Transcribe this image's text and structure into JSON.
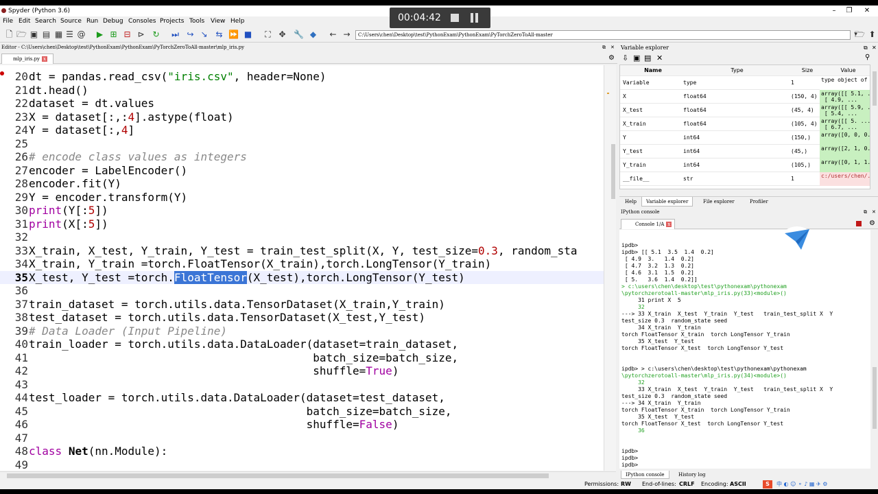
{
  "window": {
    "title": "Spyder (Python 3.6)"
  },
  "recorder": {
    "time": "00:04:42"
  },
  "menu": [
    "File",
    "Edit",
    "Search",
    "Source",
    "Run",
    "Debug",
    "Consoles",
    "Projects",
    "Tools",
    "View",
    "Help"
  ],
  "toolbar": {
    "path": "C:\\Users\\chen\\Desktop\\test\\PythonExam\\PythonExam\\PyTorchZeroToAll-master"
  },
  "editor": {
    "header": "Editor - C:\\Users\\chen\\Desktop\\test\\PythonExam\\PythonExam\\PyTorchZeroToAll-master\\mlp_iris.py",
    "tab": "mlp_iris.py",
    "lines": [
      {
        "n": "20",
        "parts": [
          [
            "",
            "dt = pandas.read_csv("
          ],
          [
            "str",
            "\"iris.csv\""
          ],
          [
            "",
            ", header=None)"
          ]
        ]
      },
      {
        "n": "21",
        "parts": [
          [
            "",
            "dt.head()"
          ]
        ]
      },
      {
        "n": "22",
        "parts": [
          [
            "",
            "dataset = dt.values"
          ]
        ]
      },
      {
        "n": "23",
        "parts": [
          [
            "",
            "X = dataset[:,:"
          ],
          [
            "num",
            "4"
          ],
          [
            "",
            "].astype(float)"
          ]
        ]
      },
      {
        "n": "24",
        "parts": [
          [
            "",
            "Y = dataset[:,"
          ],
          [
            "num",
            "4"
          ],
          [
            "",
            "]"
          ]
        ]
      },
      {
        "n": "25",
        "parts": []
      },
      {
        "n": "26",
        "parts": [
          [
            "cm",
            "# encode class values as integers"
          ]
        ]
      },
      {
        "n": "27",
        "parts": [
          [
            "",
            "encoder = LabelEncoder()"
          ]
        ]
      },
      {
        "n": "28",
        "parts": [
          [
            "",
            "encoder.fit(Y)"
          ]
        ]
      },
      {
        "n": "29",
        "parts": [
          [
            "",
            "Y = encoder.transform(Y)"
          ]
        ]
      },
      {
        "n": "30",
        "parts": [
          [
            "kw",
            "print"
          ],
          [
            "",
            "(Y[:"
          ],
          [
            "num",
            "5"
          ],
          [
            "",
            "])"
          ]
        ]
      },
      {
        "n": "31",
        "parts": [
          [
            "kw",
            "print"
          ],
          [
            "",
            "(X[:"
          ],
          [
            "num",
            "5"
          ],
          [
            "",
            "])"
          ]
        ]
      },
      {
        "n": "32",
        "parts": []
      },
      {
        "n": "33",
        "parts": [
          [
            "",
            "X_train, X_test, Y_train, Y_test = train_test_split(X, Y, test_size="
          ],
          [
            "num",
            "0.3"
          ],
          [
            "",
            ", random_sta"
          ]
        ]
      },
      {
        "n": "34",
        "parts": [
          [
            "",
            "X_train, Y_train =torch.FloatTensor(X_train),torch.LongTensor(Y_train)"
          ]
        ]
      },
      {
        "n": "35",
        "parts": [
          [
            "",
            "X_test, Y_test =torch."
          ],
          [
            "sel",
            "FloatTensor"
          ],
          [
            "",
            "(X_test),torch.LongTensor(Y_test)"
          ]
        ]
      },
      {
        "n": "36",
        "parts": []
      },
      {
        "n": "37",
        "parts": [
          [
            "",
            "train_dataset = torch.utils.data.TensorDataset(X_train,Y_train)"
          ]
        ]
      },
      {
        "n": "38",
        "parts": [
          [
            "",
            "test_dataset = torch.utils.data.TensorDataset(X_test,Y_test)"
          ]
        ]
      },
      {
        "n": "39",
        "parts": [
          [
            "cm",
            "# Data Loader (Input Pipeline)"
          ]
        ]
      },
      {
        "n": "40",
        "parts": [
          [
            "",
            "train_loader = torch.utils.data.DataLoader(dataset=train_dataset,"
          ]
        ]
      },
      {
        "n": "41",
        "parts": [
          [
            "",
            "                                           batch_size=batch_size,"
          ]
        ]
      },
      {
        "n": "42",
        "parts": [
          [
            "",
            "                                           shuffle="
          ],
          [
            "kw",
            "True"
          ],
          [
            "",
            ")"
          ]
        ]
      },
      {
        "n": "43",
        "parts": []
      },
      {
        "n": "44",
        "parts": [
          [
            "",
            "test_loader = torch.utils.data.DataLoader(dataset=test_dataset,"
          ]
        ]
      },
      {
        "n": "45",
        "parts": [
          [
            "",
            "                                          batch_size=batch_size,"
          ]
        ]
      },
      {
        "n": "46",
        "parts": [
          [
            "",
            "                                          shuffle="
          ],
          [
            "kw",
            "False"
          ],
          [
            "",
            ")"
          ]
        ]
      },
      {
        "n": "47",
        "parts": []
      },
      {
        "n": "48",
        "parts": [
          [
            "kw",
            "class"
          ],
          [
            "",
            " "
          ],
          [
            "cls",
            "Net"
          ],
          [
            "",
            "(nn.Module):"
          ]
        ]
      },
      {
        "n": "49",
        "parts": []
      }
    ]
  },
  "variable_explorer": {
    "title": "Variable explorer",
    "headers": [
      "Name",
      "Type",
      "Size",
      "Value"
    ],
    "rows": [
      {
        "name": "Variable",
        "type": "type",
        "size": "1",
        "value": "type object of builtins module"
      },
      {
        "name": "X",
        "type": "float64",
        "size": "(150, 4)",
        "value": "array([[ 5.1, ...\n [ 4.9, ..."
      },
      {
        "name": "X_test",
        "type": "float64",
        "size": "(45, 4)",
        "value": "array([[ 5.9, ...\n [ 5.4, ..."
      },
      {
        "name": "X_train",
        "type": "float64",
        "size": "(105, 4)",
        "value": "array([[ 5. ...\n [ 6.7, ..."
      },
      {
        "name": "Y",
        "type": "int64",
        "size": "(150,)",
        "value": "array([0, 0, 0..."
      },
      {
        "name": "Y_test",
        "type": "int64",
        "size": "(45,)",
        "value": "array([2, 1, 0..."
      },
      {
        "name": "Y_train",
        "type": "int64",
        "size": "(105,)",
        "value": "array([0, 1, 1..."
      },
      {
        "name": "__file__",
        "type": "str",
        "size": "1",
        "value": "c:/users/chen/..."
      }
    ],
    "tabs": [
      "Help",
      "Variable explorer",
      "File explorer",
      "Profiler"
    ]
  },
  "console": {
    "title": "IPython console",
    "tab": "Console 1/A",
    "lines": [
      {
        "t": "",
        "c": ""
      },
      {
        "t": "ipdb>",
        "c": ""
      },
      {
        "t": "ipdb> [[ 5.1  3.5  1.4  0.2]",
        "c": ""
      },
      {
        "t": " [ 4.9  3.   1.4  0.2]",
        "c": ""
      },
      {
        "t": " [ 4.7  3.2  1.3  0.2]",
        "c": ""
      },
      {
        "t": " [ 4.6  3.1  1.5  0.2]",
        "c": ""
      },
      {
        "t": " [ 5.   3.6  1.4  0.2]]",
        "c": ""
      },
      {
        "t": "> c:\\users\\chen\\desktop\\test\\pythonexam\\pythonexam",
        "c": "g"
      },
      {
        "t": "\\pytorchzerotoall-master\\mlp_iris.py(33)<module>()",
        "c": "g"
      },
      {
        "t": "     31 print X  5",
        "c": ""
      },
      {
        "t": "     32",
        "c": "g"
      },
      {
        "t": "---> 33 X_train  X_test  Y_train  Y_test   train_test_split X  Y",
        "c": ""
      },
      {
        "t": "test_size 0.3  random_state seed",
        "c": ""
      },
      {
        "t": "     34 X_train  Y_train",
        "c": ""
      },
      {
        "t": "torch FloatTensor X_train  torch LongTensor Y_train",
        "c": ""
      },
      {
        "t": "     35 X_test  Y_test",
        "c": ""
      },
      {
        "t": "torch FloatTensor X_test  torch LongTensor Y_test",
        "c": ""
      },
      {
        "t": "",
        "c": ""
      },
      {
        "t": "",
        "c": ""
      },
      {
        "t": "ipdb> > c:\\users\\chen\\desktop\\test\\pythonexam\\pythonexam",
        "c": ""
      },
      {
        "t": "\\pytorchzerotoall-master\\mlp_iris.py(34)<module>()",
        "c": "g"
      },
      {
        "t": "     32",
        "c": "g"
      },
      {
        "t": "     33 X_train  X_test  Y_train  Y_test   train_test_split X  Y",
        "c": ""
      },
      {
        "t": "test_size 0.3  random_state seed",
        "c": ""
      },
      {
        "t": "---> 34 X_train  Y_train",
        "c": ""
      },
      {
        "t": "torch FloatTensor X_train  torch LongTensor Y_train",
        "c": ""
      },
      {
        "t": "     35 X_test  Y_test",
        "c": ""
      },
      {
        "t": "torch FloatTensor X_test  torch LongTensor Y_test",
        "c": ""
      },
      {
        "t": "     36",
        "c": "g"
      },
      {
        "t": "",
        "c": ""
      },
      {
        "t": "",
        "c": ""
      },
      {
        "t": "ipdb>",
        "c": ""
      },
      {
        "t": "ipdb>",
        "c": ""
      },
      {
        "t": "ipdb>",
        "c": ""
      }
    ],
    "bottom_tabs": [
      "IPython console",
      "History log"
    ]
  },
  "status": {
    "permissions_label": "Permissions:",
    "permissions": "RW",
    "eol_label": "End-of-lines:",
    "eol": "CRLF",
    "encoding_label": "Encoding:",
    "encoding": "ASCII"
  },
  "colors": {
    "selection": "#3b75d6",
    "string": "#008000",
    "number": "#b00000",
    "keyword": "#a000a0"
  }
}
